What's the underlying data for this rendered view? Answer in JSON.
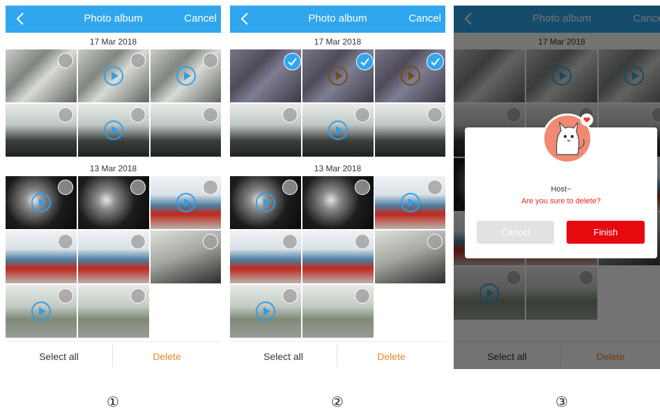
{
  "header": {
    "title": "Photo album",
    "cancel_label": "Cancel"
  },
  "sections": [
    {
      "date": "17 Mar 2018"
    },
    {
      "date": "13 Mar 2018"
    }
  ],
  "footer": {
    "select_all_label": "Select all",
    "delete_label": "Delete"
  },
  "dialog": {
    "host": "Host~",
    "message": "Are you sure to delete?",
    "cancel_label": "Cancel",
    "finish_label": "Finish"
  },
  "steps": [
    "①",
    "②",
    "③"
  ],
  "colors": {
    "header": "#30a6ee",
    "delete": "#f3841f",
    "finish": "#e8090f",
    "message": "#e8261c"
  },
  "icons": [
    "back-icon",
    "play-icon",
    "check-icon",
    "select-circle-icon",
    "cat-avatar-icon"
  ]
}
